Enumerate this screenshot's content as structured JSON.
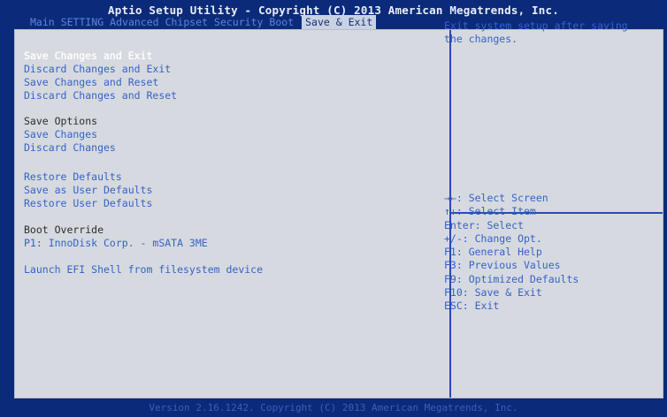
{
  "header": {
    "title": "Aptio Setup Utility - Copyright (C) 2013 American Megatrends, Inc."
  },
  "tabs": [
    {
      "label": "Main",
      "active": false
    },
    {
      "label": "SETTING",
      "active": false
    },
    {
      "label": "Advanced",
      "active": false
    },
    {
      "label": "Chipset",
      "active": false
    },
    {
      "label": "Security",
      "active": false
    },
    {
      "label": "Boot",
      "active": false
    },
    {
      "label": "Save & Exit",
      "active": true
    }
  ],
  "menu": {
    "save_changes_and_exit": "Save Changes and Exit",
    "discard_changes_and_exit": "Discard Changes and Exit",
    "save_changes_and_reset": "Save Changes and Reset",
    "discard_changes_and_reset": "Discard Changes and Reset",
    "save_options_heading": "Save Options",
    "save_changes": "Save Changes",
    "discard_changes": "Discard Changes",
    "restore_defaults": "Restore Defaults",
    "save_as_user_defaults": "Save as User Defaults",
    "restore_user_defaults": "Restore User Defaults",
    "boot_override_heading": "Boot Override",
    "boot_device": "P1: InnoDisk Corp. - mSATA 3ME",
    "launch_efi_shell": "Launch EFI Shell from filesystem device"
  },
  "help": {
    "description": "Exit system setup after saving the changes."
  },
  "keys": [
    "→←: Select Screen",
    "↑↓: Select Item",
    "Enter: Select",
    "+/-: Change Opt.",
    "F1: General Help",
    "F3: Previous Values",
    "F9: Optimized Defaults",
    "F10: Save & Exit",
    "ESC: Exit"
  ],
  "footer": {
    "version": "Version 2.16.1242. Copyright (C) 2013 American Megatrends, Inc."
  },
  "colors": {
    "frame_blue": "#0b2a7a",
    "panel_gray": "#d6d9df",
    "item_blue": "#3563c7",
    "selected_white": "#ffffff"
  }
}
